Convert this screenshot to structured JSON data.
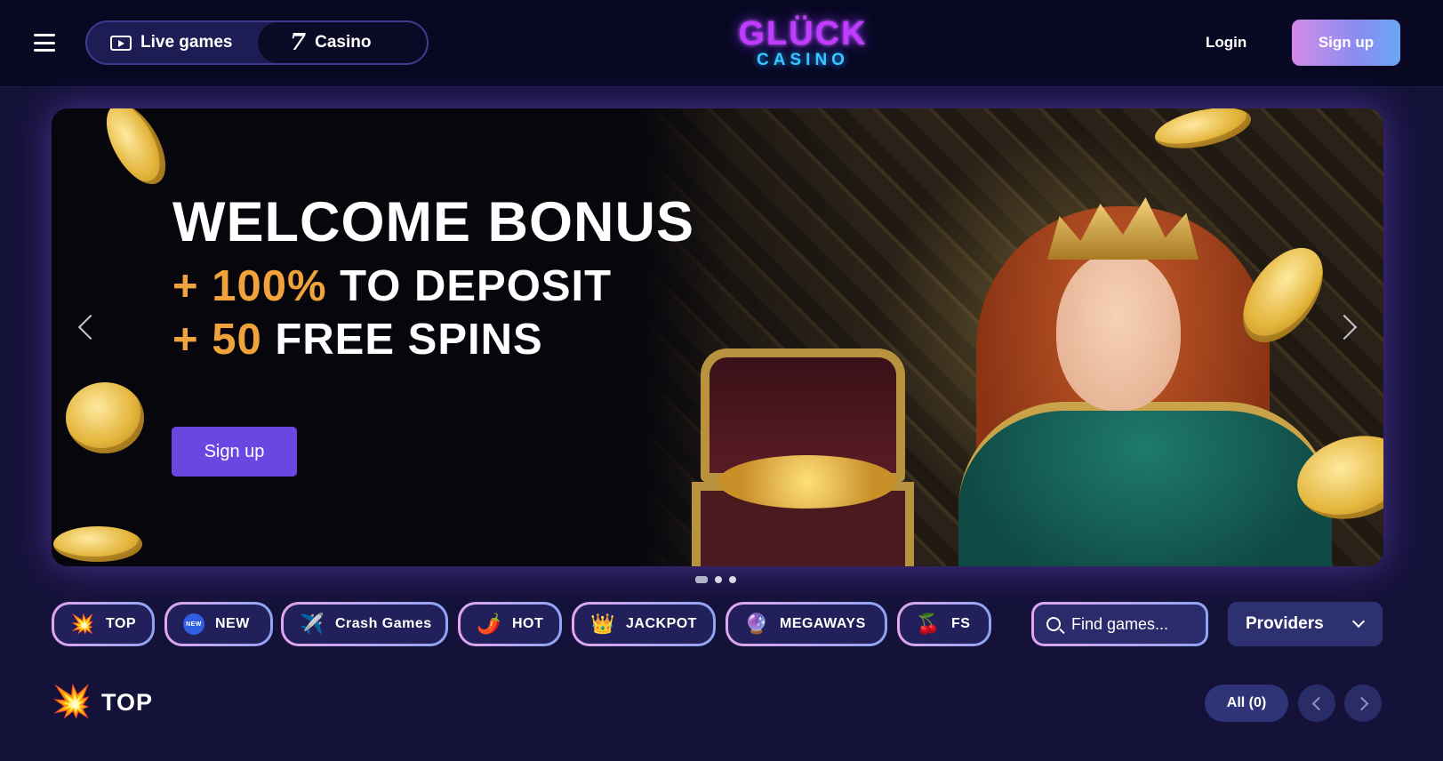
{
  "header": {
    "live_label": "Live games",
    "casino_label": "Casino",
    "logo_top": "GLÜCK",
    "logo_bottom": "CASINO",
    "login_label": "Login",
    "signup_label": "Sign up"
  },
  "hero": {
    "title": "WELCOME BONUS",
    "line1_prefix": "+ ",
    "line1_accent": "100%",
    "line1_suffix": " TO DEPOSIT",
    "line2_prefix": "+ ",
    "line2_accent": "50",
    "line2_suffix": " FREE SPINS",
    "cta_label": "Sign up",
    "slides": 3,
    "active_slide": 1
  },
  "categories": [
    {
      "label": "TOP",
      "icon": "explosion-icon",
      "glyph": "💥"
    },
    {
      "label": "NEW",
      "icon": "new-badge-icon",
      "glyph": "NEW"
    },
    {
      "label": "Crash Games",
      "icon": "airplane-icon",
      "glyph": "✈️"
    },
    {
      "label": "HOT",
      "icon": "chili-pepper-icon",
      "glyph": "🌶️"
    },
    {
      "label": "JACKPOT",
      "icon": "crown-icon",
      "glyph": "👑"
    },
    {
      "label": "MEGAWAYS",
      "icon": "crystal-ball-icon",
      "glyph": "🔮"
    },
    {
      "label": "FS",
      "icon": "cherries-icon",
      "glyph": "🍒"
    }
  ],
  "search": {
    "placeholder": "Find games..."
  },
  "providers": {
    "label": "Providers"
  },
  "section": {
    "title": "TOP",
    "icon": "explosion-icon",
    "glyph": "💥",
    "all_label": "All (0)"
  },
  "colors": {
    "background": "#15123a",
    "header": "#080823",
    "accent_orange": "#f0a23b",
    "cta_purple": "#6a47e0",
    "logo_magenta": "#c13cff",
    "logo_cyan": "#38c7ff"
  }
}
